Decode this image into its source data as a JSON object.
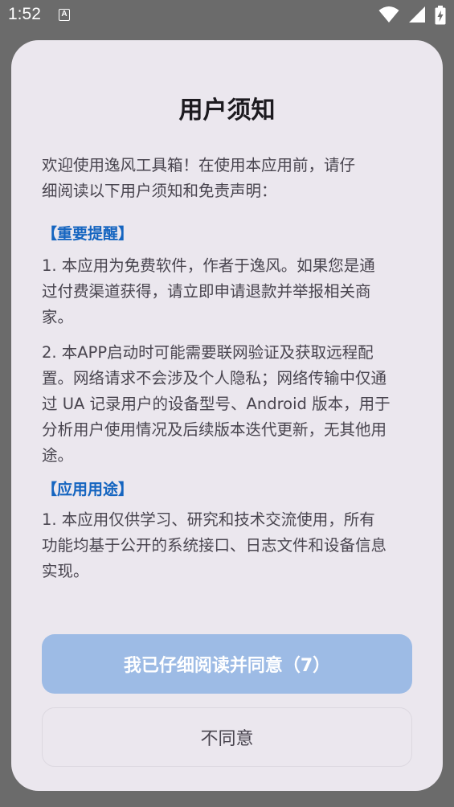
{
  "status_bar": {
    "time": "1:52",
    "notification_letter": "A",
    "icons": [
      "wifi-icon",
      "cellular-signal-icon",
      "battery-charging-icon"
    ]
  },
  "dialog": {
    "title": "用户须知",
    "intro_line1": "欢迎使用逸风工具箱！在使用本应用前，请仔",
    "intro_line2": "细阅读以下用户须知和免责声明：",
    "section1_heading": "【重要提醒】",
    "item1": {
      "line1": "1. 本应用为免费软件，作者于逸风。如果您是通",
      "line2": "过付费渠道获得，请立即申请退款并举报相关商",
      "line3": "家。"
    },
    "item2": {
      "line1": "2. 本APP启动时可能需要联网验证及获取远程配",
      "line2": "置。网络请求不会涉及个人隐私；网络传输中仅通",
      "line3": "过 UA 记录用户的设备型号、Android 版本，用于",
      "line4": "分析用户使用情况及后续版本迭代更新，无其他用",
      "line5": "途。"
    },
    "section2_heading": "【应用用途】",
    "item3": {
      "line1": "1. 本应用仅供学习、研究和技术交流使用，所有",
      "line2": "功能均基于公开的系统接口、日志文件和设备信息",
      "line3": "实现。"
    },
    "agree_label": "我已仔细阅读并同意（7）",
    "disagree_label": "不同意"
  },
  "colors": {
    "accent": "#1565c0",
    "agree_button_disabled": "#9dbbe5",
    "dialog_background": "#ebe7ee",
    "scrim": "#6b6b6b"
  }
}
